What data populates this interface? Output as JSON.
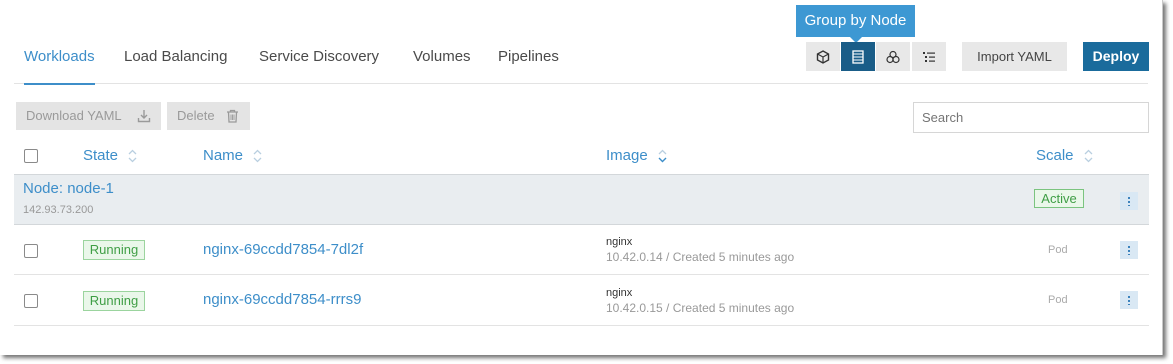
{
  "tabs": [
    {
      "label": "Workloads",
      "active": true
    },
    {
      "label": "Load Balancing",
      "active": false
    },
    {
      "label": "Service Discovery",
      "active": false
    },
    {
      "label": "Volumes",
      "active": false
    },
    {
      "label": "Pipelines",
      "active": false
    }
  ],
  "tooltip": "Group by Node",
  "group_buttons": [
    {
      "icon": "cube-icon",
      "active": false
    },
    {
      "icon": "server-icon",
      "active": true
    },
    {
      "icon": "cluster-icon",
      "active": false
    },
    {
      "icon": "list-icon",
      "active": false
    }
  ],
  "toolbar": {
    "import_label": "Import YAML",
    "deploy_label": "Deploy"
  },
  "bulk": {
    "download_label": "Download YAML",
    "delete_label": "Delete"
  },
  "search": {
    "placeholder": "Search",
    "value": ""
  },
  "table": {
    "headers": {
      "state": "State",
      "name": "Name",
      "image": "Image",
      "scale": "Scale"
    },
    "group": {
      "title": "Node: node-1",
      "ip": "142.93.73.200",
      "status": "Active"
    },
    "rows": [
      {
        "state": "Running",
        "name": "nginx-69ccdd7854-7dl2f",
        "image": "nginx",
        "meta": "10.42.0.14 / Created 5 minutes ago",
        "scale": "Pod"
      },
      {
        "state": "Running",
        "name": "nginx-69ccdd7854-rrrs9",
        "image": "nginx",
        "meta": "10.42.0.15 / Created 5 minutes ago",
        "scale": "Pod"
      }
    ]
  },
  "colors": {
    "accent": "#3d8ec9",
    "deploy": "#1a6b9c",
    "active_group_button": "#1a5d88",
    "running": "#3f9e45"
  }
}
